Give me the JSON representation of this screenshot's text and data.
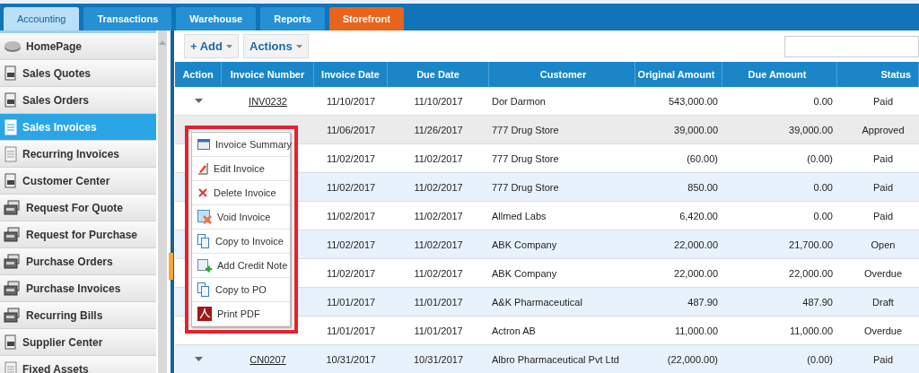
{
  "tabs": [
    {
      "label": "Accounting",
      "selected": true,
      "kind": "normal"
    },
    {
      "label": "Transactions",
      "selected": false,
      "kind": "normal"
    },
    {
      "label": "Warehouse",
      "selected": false,
      "kind": "normal"
    },
    {
      "label": "Reports",
      "selected": false,
      "kind": "normal"
    },
    {
      "label": "Storefront",
      "selected": false,
      "kind": "highlight"
    }
  ],
  "sidebar": {
    "items": [
      {
        "label": "HomePage",
        "selected": false,
        "kind": "home"
      },
      {
        "label": "Sales Quotes",
        "selected": false,
        "kind": "doc"
      },
      {
        "label": "Sales Orders",
        "selected": false,
        "kind": "doc"
      },
      {
        "label": "Sales Invoices",
        "selected": true,
        "kind": "page"
      },
      {
        "label": "Recurring Invoices",
        "selected": false,
        "kind": "page"
      },
      {
        "label": "Customer Center",
        "selected": false,
        "kind": "doc"
      },
      {
        "label": "Request For Quote",
        "selected": false,
        "kind": "stack"
      },
      {
        "label": "Request for Purchase",
        "selected": false,
        "kind": "stack"
      },
      {
        "label": "Purchase Orders",
        "selected": false,
        "kind": "stack"
      },
      {
        "label": "Purchase Invoices",
        "selected": false,
        "kind": "stack"
      },
      {
        "label": "Recurring Bills",
        "selected": false,
        "kind": "stack"
      },
      {
        "label": "Supplier Center",
        "selected": false,
        "kind": "doc"
      },
      {
        "label": "Fixed Assets",
        "selected": false,
        "kind": "page"
      }
    ]
  },
  "toolbar": {
    "buttons": [
      "+ Add",
      "Actions"
    ]
  },
  "table": {
    "columns": [
      "Action",
      "Invoice Number",
      "Invoice Date",
      "Due Date",
      "Customer",
      "Original Amount",
      "Due Amount",
      "Status"
    ],
    "rows": [
      {
        "selected": false,
        "invoice_number": "INV0232",
        "invoice_date": "11/10/2017",
        "due_date": "11/10/2017",
        "customer": "Dor Darmon",
        "original_amount": "543,000.00",
        "due_amount": "0.00",
        "status": "Paid"
      },
      {
        "selected": true,
        "invoice_date": "11/06/2017",
        "due_date": "11/26/2017",
        "customer": "777 Drug Store",
        "original_amount": "39,000.00",
        "due_amount": "39,000.00",
        "status": "Approved"
      },
      {
        "selected": false,
        "invoice_date": "11/02/2017",
        "due_date": "11/02/2017",
        "customer": "777 Drug Store",
        "original_amount": "(60.00)",
        "due_amount": "(0.00)",
        "status": "Paid"
      },
      {
        "selected": false,
        "invoice_date": "11/02/2017",
        "due_date": "11/02/2017",
        "customer": "777 Drug Store",
        "original_amount": "850.00",
        "due_amount": "0.00",
        "status": "Paid"
      },
      {
        "selected": false,
        "invoice_date": "11/02/2017",
        "due_date": "11/02/2017",
        "customer": "Allmed Labs",
        "original_amount": "6,420.00",
        "due_amount": "0.00",
        "status": "Paid"
      },
      {
        "selected": false,
        "invoice_date": "11/02/2017",
        "due_date": "11/02/2017",
        "customer": "ABK Company",
        "original_amount": "22,000.00",
        "due_amount": "21,700.00",
        "status": "Open"
      },
      {
        "selected": false,
        "invoice_date": "11/02/2017",
        "due_date": "11/02/2017",
        "customer": "ABK Company",
        "original_amount": "22,000.00",
        "due_amount": "22,000.00",
        "status": "Overdue"
      },
      {
        "selected": false,
        "invoice_date": "11/01/2017",
        "due_date": "11/01/2017",
        "customer": "A&K Pharmaceutical",
        "original_amount": "487.90",
        "due_amount": "487.90",
        "status": "Draft"
      },
      {
        "selected": false,
        "invoice_date": "11/01/2017",
        "due_date": "11/01/2017",
        "customer": "Actron AB",
        "original_amount": "11,000.00",
        "due_amount": "11,000.00",
        "status": "Overdue"
      },
      {
        "selected": false,
        "invoice_number": "CN0207",
        "invoice_date": "10/31/2017",
        "due_date": "10/31/2017",
        "customer": "Albro Pharmaceutical Pvt Ltd",
        "original_amount": "(22,000.00)",
        "due_amount": "(0.00)",
        "status": "Paid"
      }
    ]
  },
  "context_menu": {
    "items": [
      {
        "label": "Invoice Summary",
        "kind": "summary"
      },
      {
        "label": "Edit Invoice",
        "kind": "edit"
      },
      {
        "label": "Delete Invoice",
        "kind": "delete"
      },
      {
        "label": "Void Invoice",
        "kind": "void"
      },
      {
        "label": "Copy to Invoice",
        "kind": "copy"
      },
      {
        "label": "Add Credit Note",
        "kind": "credit"
      },
      {
        "label": "Copy to PO",
        "kind": "copy"
      },
      {
        "label": "Print PDF",
        "kind": "pdf"
      }
    ]
  }
}
